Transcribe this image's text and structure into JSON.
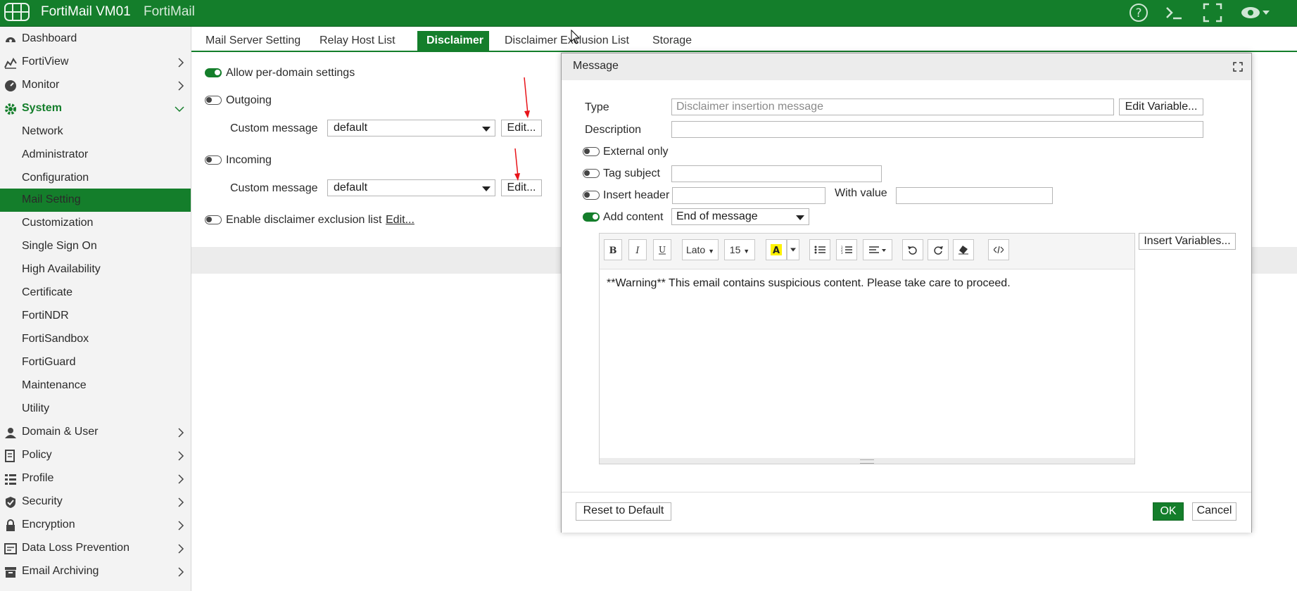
{
  "app": {
    "title": "FortiMail VM01",
    "subtitle": "FortiMail",
    "brand_color": "#147e2b"
  },
  "topbar_icons": [
    "grid-icon",
    "help-icon",
    "cli-console-icon",
    "fullscreen-icon",
    "eye-icon"
  ],
  "sidebar": {
    "items": [
      {
        "label": "Dashboard",
        "icon": "dashboard-icon"
      },
      {
        "label": "FortiView",
        "icon": "fortiview-icon"
      },
      {
        "label": "Monitor",
        "icon": "monitor-icon"
      },
      {
        "label": "System",
        "icon": "gear-icon",
        "expanded": true
      },
      {
        "label": "Domain & User",
        "icon": "user-icon"
      },
      {
        "label": "Policy",
        "icon": "policy-icon"
      },
      {
        "label": "Profile",
        "icon": "list-icon"
      },
      {
        "label": "Security",
        "icon": "shield-icon"
      },
      {
        "label": "Encryption",
        "icon": "lock-icon"
      },
      {
        "label": "Data Loss Prevention",
        "icon": "dlp-icon"
      },
      {
        "label": "Email Archiving",
        "icon": "archive-icon"
      }
    ],
    "system_sub": [
      "Network",
      "Administrator",
      "Configuration",
      "Mail Setting",
      "Customization",
      "Single Sign On",
      "High Availability",
      "Certificate",
      "FortiNDR",
      "FortiSandbox",
      "FortiGuard",
      "Maintenance",
      "Utility"
    ],
    "active_sub": "Mail Setting"
  },
  "tabs": [
    "Mail Server Setting",
    "Relay Host List",
    "Disclaimer",
    "Disclaimer Exclusion List",
    "Storage"
  ],
  "active_tab": "Disclaimer",
  "disclaimer": {
    "allow_per_domain": {
      "label": "Allow per-domain settings",
      "enabled": true
    },
    "outgoing": {
      "label": "Outgoing",
      "enabled": false,
      "custom_label": "Custom message",
      "custom_value": "default",
      "edit_label": "Edit..."
    },
    "incoming": {
      "label": "Incoming",
      "enabled": false,
      "custom_label": "Custom message",
      "custom_value": "default",
      "edit_label": "Edit..."
    },
    "exclusion": {
      "label": "Enable disclaimer exclusion list",
      "enabled": false,
      "edit_label": "Edit..."
    }
  },
  "modal": {
    "title": "Message",
    "type_label": "Type",
    "type_placeholder": "Disclaimer insertion message",
    "edit_variable_label": "Edit Variable...",
    "description_label": "Description",
    "description_value": "",
    "external_only": {
      "label": "External only",
      "enabled": false
    },
    "tag_subject": {
      "label": "Tag subject",
      "enabled": false,
      "value": ""
    },
    "insert_header": {
      "label": "Insert header",
      "enabled": false,
      "value": "",
      "with_value_label": "With value",
      "with_value": ""
    },
    "add_content": {
      "label": "Add content",
      "enabled": true,
      "position": "End of message"
    },
    "insert_variables_label": "Insert Variables...",
    "editor": {
      "font": "Lato",
      "size": "15",
      "content": "**Warning** This email contains suspicious content. Please take care to proceed."
    },
    "reset_label": "Reset to Default",
    "ok_label": "OK",
    "cancel_label": "Cancel"
  }
}
